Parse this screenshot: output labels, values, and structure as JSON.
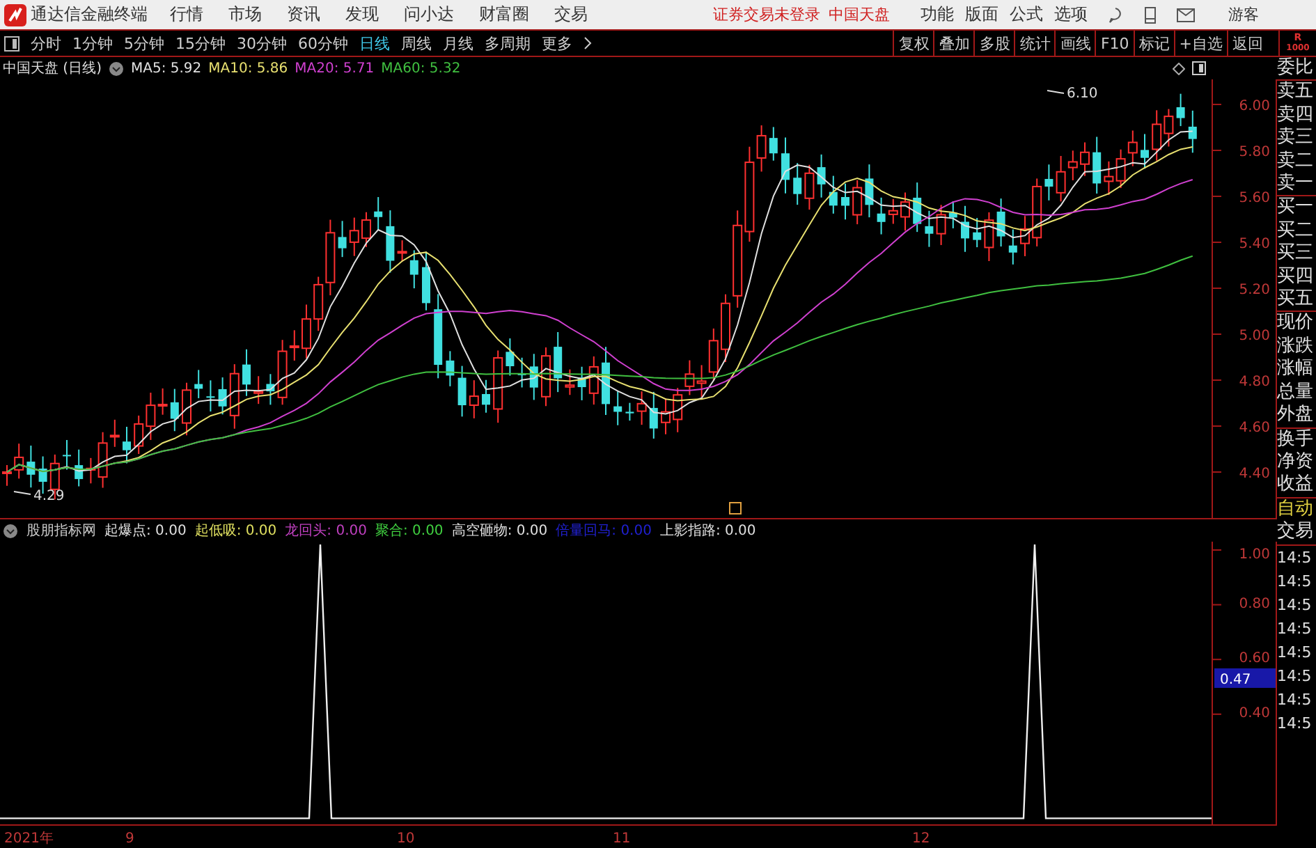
{
  "app": {
    "title": "通达信金融终端"
  },
  "menu": [
    "行情",
    "市场",
    "资讯",
    "发现",
    "问小达",
    "财富圈",
    "交易"
  ],
  "status": [
    "证券交易未登录",
    "中国天盘"
  ],
  "menu_right": [
    "功能",
    "版面",
    "公式",
    "选项"
  ],
  "user": "游客",
  "periods": [
    {
      "label": "分时",
      "selected": false
    },
    {
      "label": "1分钟",
      "selected": false
    },
    {
      "label": "5分钟",
      "selected": false
    },
    {
      "label": "15分钟",
      "selected": false
    },
    {
      "label": "30分钟",
      "selected": false
    },
    {
      "label": "60分钟",
      "selected": false
    },
    {
      "label": "日线",
      "selected": true
    },
    {
      "label": "周线",
      "selected": false
    },
    {
      "label": "月线",
      "selected": false
    },
    {
      "label": "多周期",
      "selected": false
    },
    {
      "label": "更多",
      "selected": false
    }
  ],
  "tools": [
    "复权",
    "叠加",
    "多股",
    "统计",
    "画线",
    "F10",
    "标记",
    "+自选",
    "返回"
  ],
  "corner_badge": [
    "R",
    "1000"
  ],
  "chart": {
    "title": "中国天盘 (日线)",
    "ma": [
      {
        "label": "MA5: 5.92",
        "color": "#e0e0e0"
      },
      {
        "label": "MA10: 5.86",
        "color": "#e8e070"
      },
      {
        "label": "MA20: 5.71",
        "color": "#d040d0"
      },
      {
        "label": "MA60: 5.32",
        "color": "#40c040"
      }
    ],
    "price_ticks": [
      "6.00",
      "5.80",
      "5.60",
      "5.40",
      "5.20",
      "5.00",
      "4.80",
      "4.60",
      "4.40"
    ],
    "high_label": "6.10",
    "low_label": "4.29"
  },
  "indicator": {
    "name": "股朋指标网",
    "items": [
      {
        "label": "起爆点: 0.00",
        "color": "#e0e0e0"
      },
      {
        "label": "起低吸: 0.00",
        "color": "#e0e060"
      },
      {
        "label": "龙回头: 0.00",
        "color": "#c040c0"
      },
      {
        "label": "聚合: 0.00",
        "color": "#40d040"
      },
      {
        "label": "高空砸物: 0.00",
        "color": "#e0e0e0"
      },
      {
        "label": "倍量回马: 0.00",
        "color": "#2020d0"
      },
      {
        "label": "上影指路: 0.00",
        "color": "#e0e0e0"
      }
    ],
    "ticks": [
      "1.00",
      "0.80",
      "0.60",
      "0.40"
    ],
    "cursor_value": "0.47"
  },
  "x_axis": [
    "2021年",
    "9",
    "10",
    "11",
    "12"
  ],
  "side_panel": {
    "groups": [
      [
        "委比"
      ],
      [
        "卖五",
        "卖四",
        "卖三",
        "卖二",
        "卖一"
      ],
      [
        "买一",
        "买二",
        "买三",
        "买四",
        "买五"
      ],
      [
        "现价",
        "涨跌",
        "涨幅",
        "总量",
        "外盘"
      ],
      [
        "换手",
        "净资",
        "收益"
      ]
    ],
    "auto_trade": [
      "自动",
      "交易"
    ],
    "times": [
      "14:5",
      "14:5",
      "14:5",
      "14:5",
      "14:5",
      "14:5",
      "14:5",
      "14:5"
    ]
  }
}
